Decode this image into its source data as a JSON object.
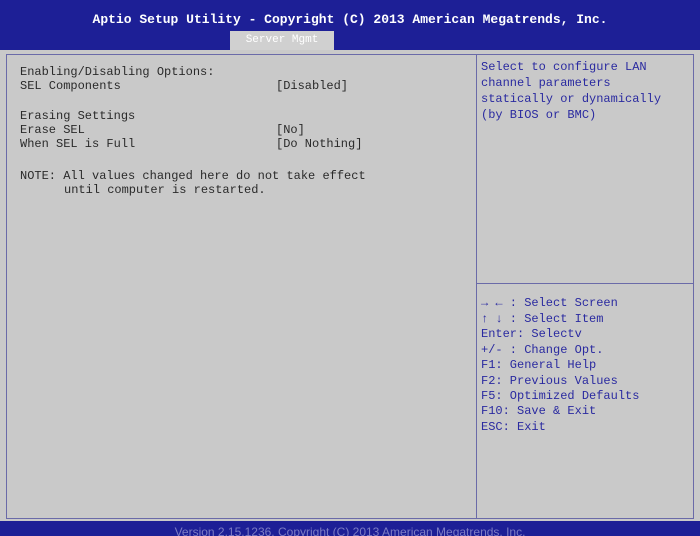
{
  "header": {
    "title": "Aptio Setup Utility - Copyright (C) 2013 American Megatrends, Inc.",
    "tab": "Server Mgmt"
  },
  "settings": {
    "section1_heading": "Enabling/Disabling Options:",
    "sel_components_label": "SEL Components",
    "sel_components_value": "[Disabled]",
    "section2_heading": "Erasing Settings",
    "erase_sel_label": "Erase SEL",
    "erase_sel_value": "[No]",
    "when_full_label": "When SEL is Full",
    "when_full_value": "[Do Nothing]",
    "note_line1": "NOTE: All values changed here do not take effect",
    "note_line2": "until computer is restarted."
  },
  "help": {
    "lines": [
      "Select to configure LAN",
      "channel parameters",
      "statically or dynamically",
      "(by BIOS or BMC)"
    ]
  },
  "keys": [
    "→ ← : Select Screen",
    "↑ ↓ : Select Item",
    "Enter: Selectv",
    "+/- : Change Opt.",
    "F1: General Help",
    "F2: Previous Values",
    "F5: Optimized Defaults",
    "F10: Save & Exit",
    "ESC: Exit"
  ],
  "footer": {
    "text": "Version 2.15.1236. Copyright (C) 2013 American Megatrends, Inc."
  },
  "colors": {
    "bar": "#1d1f96",
    "background": "#c9c9c9",
    "help_text": "#2a2aa0"
  }
}
